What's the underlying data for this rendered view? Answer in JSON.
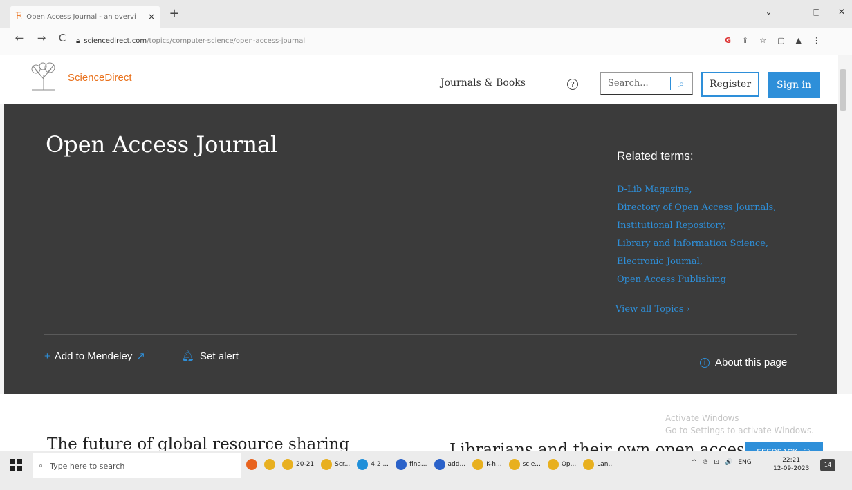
{
  "browser": {
    "tab_title": "Open Access Journal - an overvi",
    "tab_close": "×",
    "new_tab": "+",
    "window_controls": [
      "⌄",
      "–",
      "▢",
      "✕"
    ],
    "nav": {
      "back": "←",
      "forward": "→",
      "reload": "C"
    },
    "url_host": "sciencedirect.com",
    "url_path": "/topics/computer-science/open-access-journal",
    "ext_icons": [
      "G",
      "⇪",
      "☆",
      "▢",
      "▲",
      "⋮"
    ]
  },
  "header": {
    "brand": "ScienceDirect",
    "nav_journals": "Journals & Books",
    "help_icon": "?",
    "search_placeholder": "Search...",
    "register": "Register",
    "signin": "Sign in"
  },
  "hero": {
    "title": "Open Access Journal",
    "related_heading": "Related terms:",
    "related_terms": [
      "D-Lib Magazine,",
      "Directory of Open Access Journals,",
      "Institutional Repository,",
      "Library and Information Science,",
      "Electronic Journal,",
      "Open Access Publishing"
    ],
    "view_all": "View all Topics",
    "add_mendeley": "Add to Mendeley",
    "set_alert": "Set alert",
    "about": "About this page"
  },
  "content": {
    "article_1": "The future of global resource sharing",
    "article_2": "Librarians and their own open access",
    "activate_line1": "Activate Windows",
    "activate_line2": "Go to Settings to activate Windows.",
    "feedback": "FEEDBACK"
  },
  "taskbar": {
    "search_placeholder": "Type here to search",
    "apps": [
      {
        "label": "",
        "color": "#e8631f"
      },
      {
        "label": "",
        "color": "#e8b01f"
      },
      {
        "label": "20-21",
        "color": "#e8b01f"
      },
      {
        "label": "Scr...",
        "color": "#e8b01f"
      },
      {
        "label": "4.2 ...",
        "color": "#1f8fd9"
      },
      {
        "label": "fina...",
        "color": "#2b62c9"
      },
      {
        "label": "add...",
        "color": "#2b62c9"
      },
      {
        "label": "K-h...",
        "color": "#e8b01f"
      },
      {
        "label": "scie...",
        "color": "#e8b01f"
      },
      {
        "label": "Op...",
        "color": "#e8b01f"
      },
      {
        "label": "Lan...",
        "color": "#e8b01f"
      }
    ],
    "tray": [
      "^",
      "℗",
      "⊡",
      "🔊",
      "ENG"
    ],
    "time": "22:21",
    "date": "12-09-2023",
    "notifications": "14"
  }
}
